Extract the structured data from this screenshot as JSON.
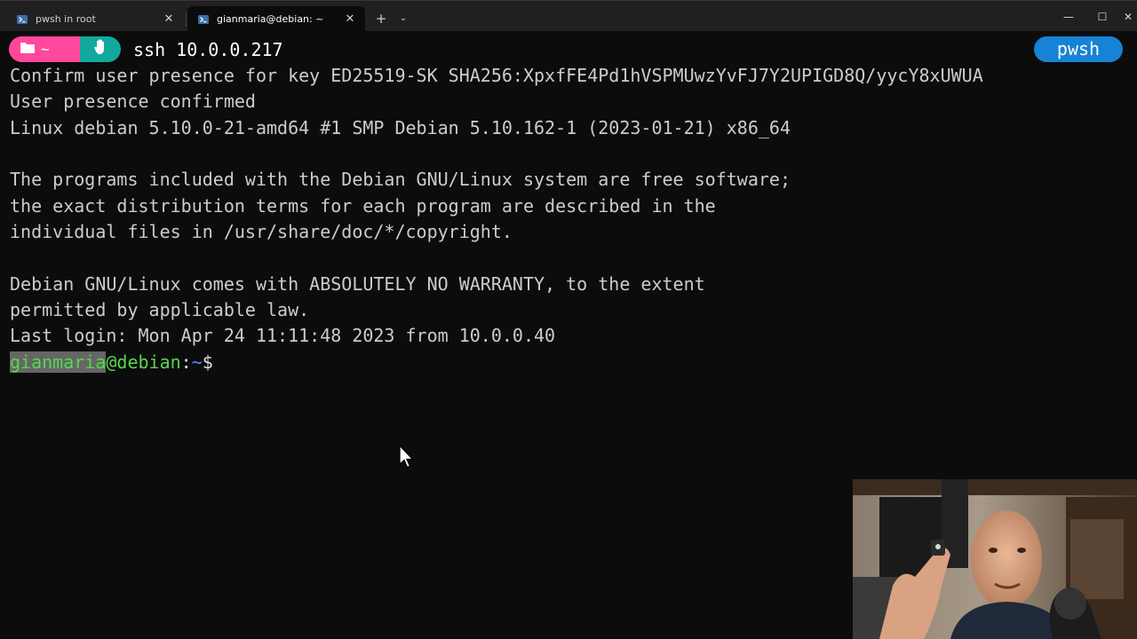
{
  "tabs": [
    {
      "label": "pwsh in root",
      "icon": "powershell-icon",
      "active": false
    },
    {
      "label": "gianmaria@debian: ~",
      "icon": "powershell-icon",
      "active": true
    }
  ],
  "titlebar": {
    "new_tab": "+",
    "dropdown": "⌄",
    "minimize": "—",
    "maximize": "☐",
    "close": "✕",
    "tab_close": "✕"
  },
  "prompt": {
    "path_symbol": "~",
    "command": "ssh 10.0.0.217",
    "shell_badge": "pwsh",
    "colors": {
      "path_segment": "#ff479c",
      "git_segment": "#13a89e",
      "shell_badge": "#1683d4"
    }
  },
  "output_lines": [
    "Confirm user presence for key ED25519-SK SHA256:XpxfFE4Pd1hVSPMUwzYvFJ7Y2UPIGD8Q/yycY8xUWUA",
    "User presence confirmed",
    "Linux debian 5.10.0-21-amd64 #1 SMP Debian 5.10.162-1 (2023-01-21) x86_64",
    "",
    "The programs included with the Debian GNU/Linux system are free software;",
    "the exact distribution terms for each program are described in the",
    "individual files in /usr/share/doc/*/copyright.",
    "",
    "Debian GNU/Linux comes with ABSOLUTELY NO WARRANTY, to the extent",
    "permitted by applicable law.",
    "Last login: Mon Apr 24 11:11:48 2023 from 10.0.0.40"
  ],
  "shell_prompt": {
    "user": "gianmaria",
    "host": "@debian",
    "colon": ":",
    "cwd": "~",
    "dollar": "$"
  }
}
